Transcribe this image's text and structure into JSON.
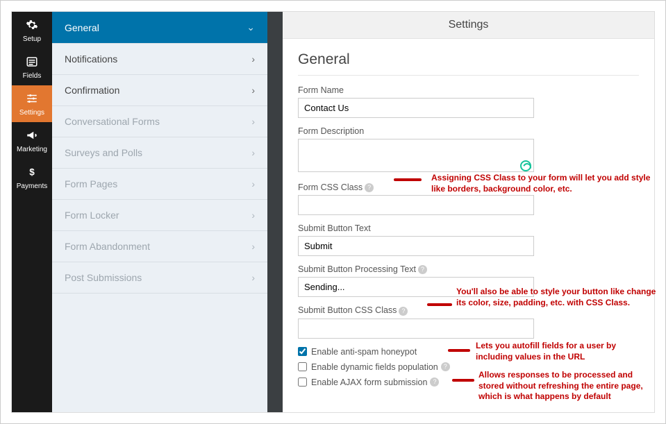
{
  "titlebar": "Settings",
  "iconbar": {
    "setup": "Setup",
    "fields": "Fields",
    "settings": "Settings",
    "marketing": "Marketing",
    "payments": "Payments"
  },
  "secondary": {
    "general": "General",
    "notifications": "Notifications",
    "confirmation": "Confirmation",
    "convo": "Conversational Forms",
    "surveys": "Surveys and Polls",
    "pages": "Form Pages",
    "locker": "Form Locker",
    "abandon": "Form Abandonment",
    "post": "Post Submissions"
  },
  "panel": {
    "heading": "General",
    "form_name_label": "Form Name",
    "form_name_value": "Contact Us",
    "form_desc_label": "Form Description",
    "form_desc_value": "",
    "css_label": "Form CSS Class",
    "css_value": "",
    "submit_text_label": "Submit Button Text",
    "submit_text_value": "Submit",
    "submit_proc_label": "Submit Button Processing Text",
    "submit_proc_value": "Sending...",
    "submit_css_label": "Submit Button CSS Class",
    "submit_css_value": "",
    "chk_honeypot": "Enable anti-spam honeypot",
    "chk_dynamic": "Enable dynamic fields population",
    "chk_ajax": "Enable AJAX form submission"
  },
  "annotations": {
    "a1": "Assigning CSS Class to your form will let you add style like borders, background color, etc.",
    "a2": "You'll also be able to style your button like change its color, size, padding, etc. with CSS Class.",
    "a3": "Lets you autofill fields for a user by including values in the URL",
    "a4": "Allows responses to be processed and stored without refreshing the entire page, which is what happens by default"
  }
}
